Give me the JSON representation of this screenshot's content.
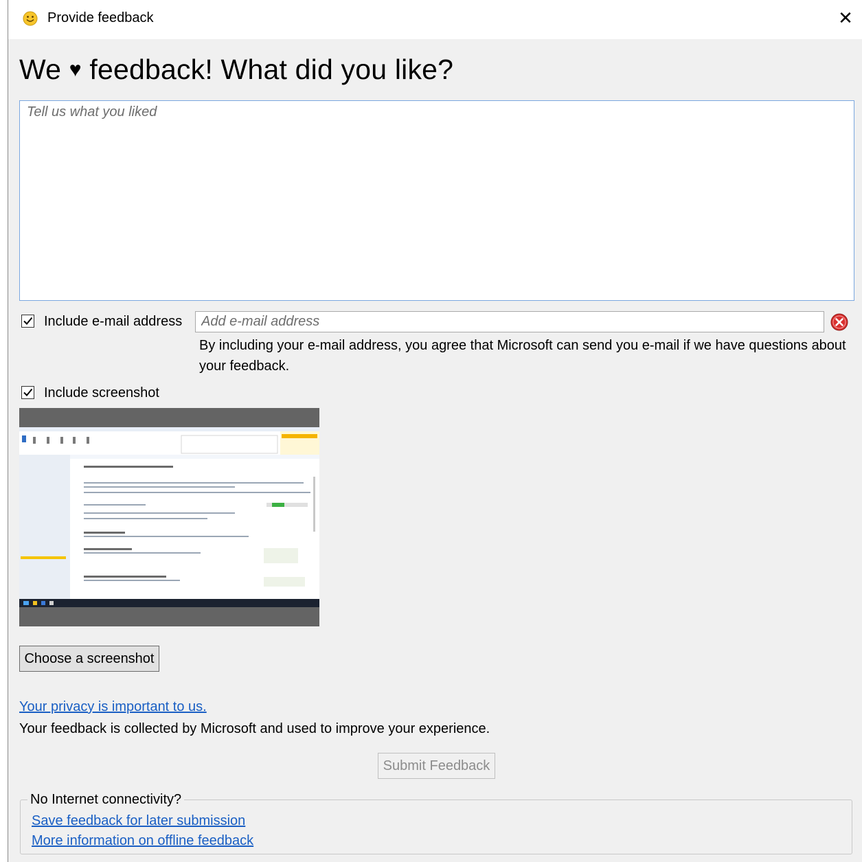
{
  "window": {
    "title": "Provide feedback",
    "close_glyph": "✕"
  },
  "heading": {
    "part1": "We",
    "heart": "♥",
    "part2": "feedback! What did you like?"
  },
  "feedback": {
    "placeholder": "Tell us what you liked",
    "value": ""
  },
  "email": {
    "checkbox_label": "Include e-mail address",
    "checked": true,
    "placeholder": "Add e-mail address",
    "value": "",
    "note": "By including your e-mail address, you agree that Microsoft can send you e-mail if we have questions about your feedback."
  },
  "screenshot": {
    "checkbox_label": "Include screenshot",
    "checked": true,
    "choose_label": "Choose a screenshot"
  },
  "privacy": {
    "link": "Your privacy is important to us.",
    "text": "Your feedback is collected by Microsoft and used to improve your experience."
  },
  "submit_label": "Submit Feedback",
  "offline": {
    "legend": "No Internet connectivity?",
    "save_link": "Save feedback for later submission",
    "info_link": "More information on offline feedback"
  },
  "colors": {
    "accent_link": "#1a5fc4",
    "focus_border": "#7aa7e0",
    "clear_icon": "#d9302f"
  }
}
